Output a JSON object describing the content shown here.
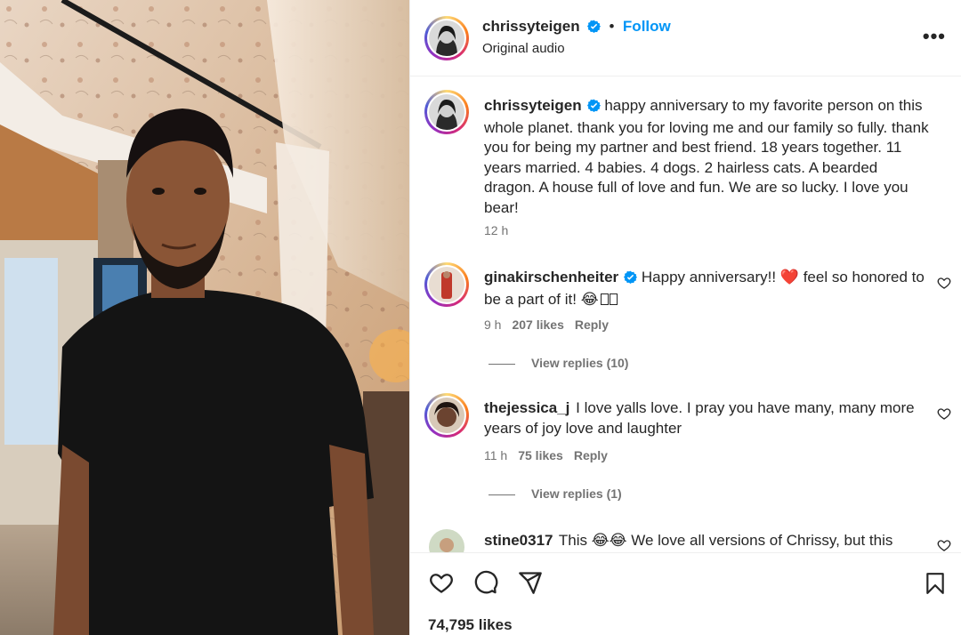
{
  "post": {
    "username": "chrissyteigen",
    "follow_label": "Follow",
    "separator": "•",
    "audio": "Original audio",
    "more_label": "•••",
    "caption": "happy anniversary to my favorite person on this whole planet. thank you for loving me and our family so fully. thank you for being my partner and best friend. 18 years together. 11 years married. 4 babies. 4 dogs. 2 hairless cats. A bearded dragon. A house full of love and fun. We are so lucky. I love you bear!",
    "caption_time": "12 h"
  },
  "comments": [
    {
      "username": "ginakirschenheiter",
      "verified": true,
      "text_a": "Happy anniversary!! ",
      "emoji_a": "❤️",
      "text_b": " feel so honored to be a part of it! ",
      "emoji_b": "😂",
      "text_c": "",
      "time": "9 h",
      "likes": "207 likes",
      "reply_label": "Reply",
      "view_replies": "View replies (10)"
    },
    {
      "username": "thejessica_j",
      "verified": false,
      "text": "I love yalls love. I pray you have many, many more years of joy love and laughter",
      "time": "11 h",
      "likes": "75 likes",
      "reply_label": "Reply",
      "view_replies": "View replies (1)"
    },
    {
      "username": "stine0317",
      "verified": false,
      "text_a": "This ",
      "emoji_a": "😂😂",
      "text_b": " We love all versions of Chrissy, but this"
    }
  ],
  "footer": {
    "likes_count": "74,795 likes"
  },
  "colors": {
    "accent": "#0095f6",
    "text": "#262626",
    "secondary": "#737373",
    "heart_red": "#e0245e"
  },
  "icons": [
    "verified-badge-icon",
    "heart-icon",
    "comment-icon",
    "share-icon",
    "bookmark-icon",
    "more-options-icon"
  ]
}
